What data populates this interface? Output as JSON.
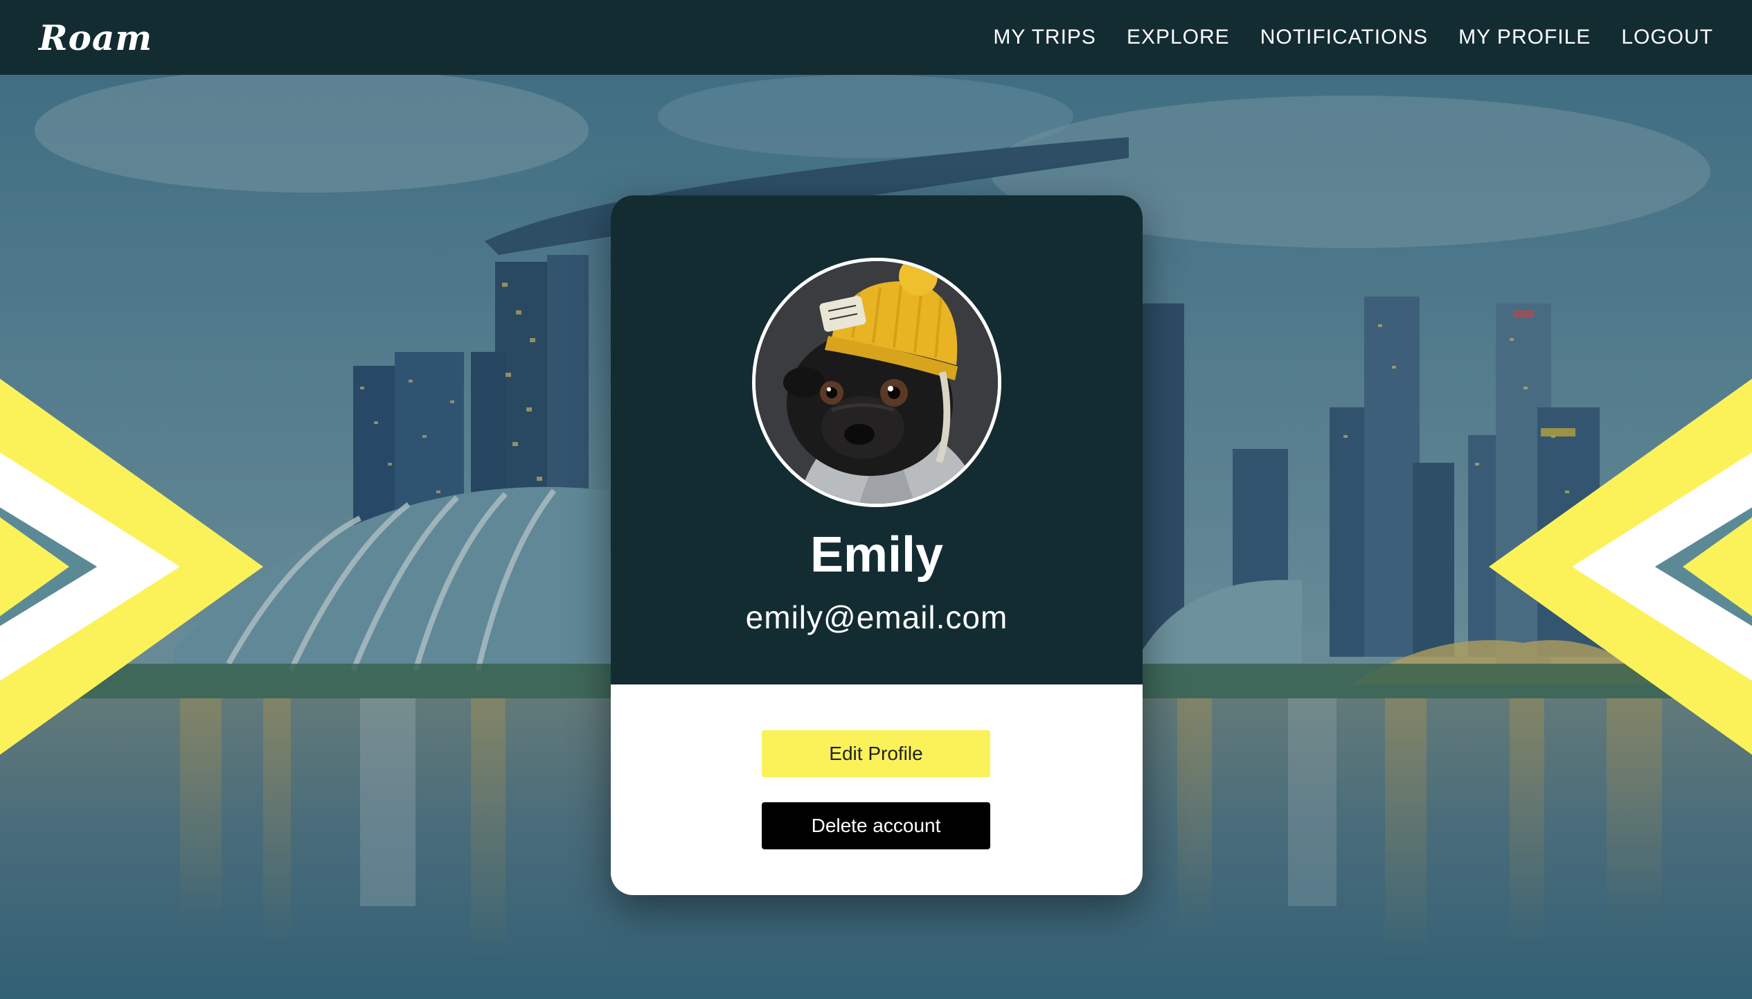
{
  "app": {
    "logo": "Roam"
  },
  "nav": {
    "links": [
      "MY TRIPS",
      "EXPLORE",
      "NOTIFICATIONS",
      "MY PROFILE",
      "LOGOUT"
    ]
  },
  "profile": {
    "name": "Emily",
    "email": "emily@email.com",
    "edit_label": "Edit Profile",
    "delete_label": "Delete account"
  },
  "colors": {
    "navbar": "#132c32",
    "accent_yellow": "#fbf25a",
    "delete_button": "#000000",
    "card_bottom": "#ffffff"
  },
  "icons": {
    "avatar": "pug-in-yellow-beanie-photo"
  }
}
